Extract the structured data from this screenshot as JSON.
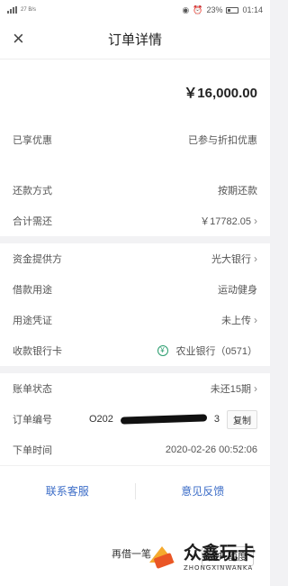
{
  "status_bar": {
    "network": "27 B/s",
    "battery": "23%",
    "time": "01:14"
  },
  "header": {
    "title": "订单详情"
  },
  "amount": {
    "value": "￥16,000.00"
  },
  "discount": {
    "label": "已享优惠",
    "value": "已参与折扣优惠"
  },
  "repayment": {
    "method_label": "还款方式",
    "method_value": "按期还款",
    "total_label": "合计需还",
    "total_value": "￥17782.05"
  },
  "fund": {
    "provider_label": "资金提供方",
    "provider_value": "光大银行",
    "purpose_label": "借款用途",
    "purpose_value": "运动健身",
    "proof_label": "用途凭证",
    "proof_value": "未上传",
    "card_label": "收款银行卡",
    "card_value": "农业银行（0571）"
  },
  "account": {
    "status_label": "账单状态",
    "status_value": "未还15期",
    "order_label": "订单编号",
    "order_value_prefix": "O202",
    "order_value_suffix": "3",
    "copy_label": "复制",
    "time_label": "下单时间",
    "time_value": "2020-02-26 00:52:06"
  },
  "actions": {
    "service": "联系客服",
    "feedback": "意见反馈"
  },
  "bottom": {
    "left_button": "再借一笔",
    "right_button": "提升额度"
  },
  "watermark": {
    "cn": "众鑫玩卡",
    "en": "ZHONGXINWANKA"
  }
}
